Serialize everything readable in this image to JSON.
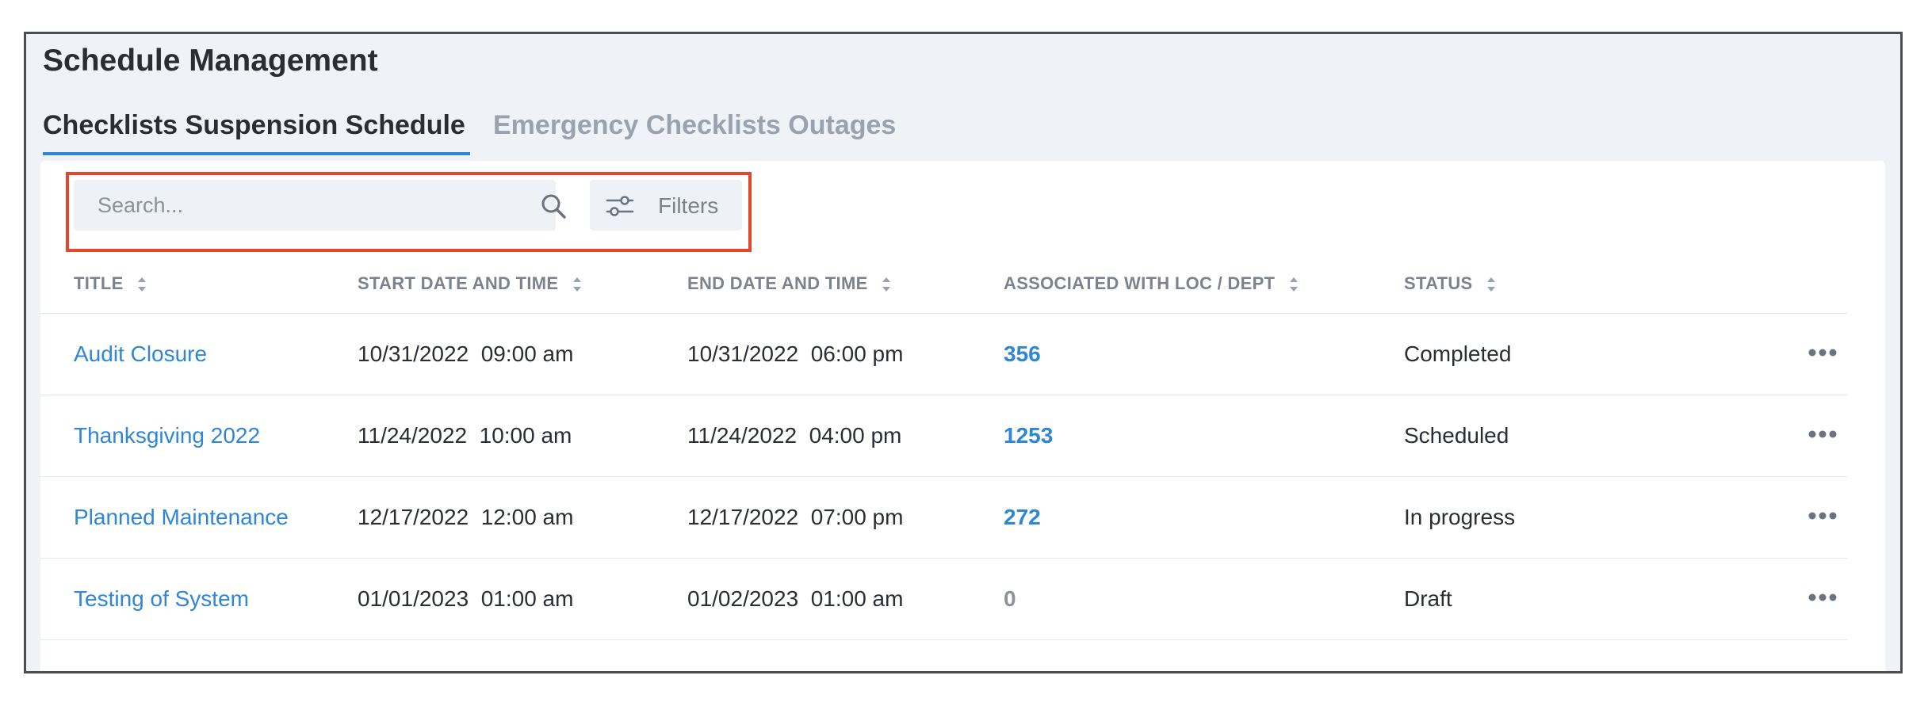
{
  "page": {
    "title": "Schedule Management"
  },
  "tabs": [
    {
      "label": "Checklists Suspension Schedule",
      "active": true
    },
    {
      "label": "Emergency Checklists Outages",
      "active": false
    }
  ],
  "toolbar": {
    "search_placeholder": "Search...",
    "search_value": "",
    "search_icon": "search-icon",
    "filters_label": "Filters",
    "filters_icon": "sliders-icon"
  },
  "table": {
    "columns": [
      "TITLE",
      "START DATE AND TIME",
      "END DATE AND TIME",
      "ASSOCIATED WITH LOC / DEPT",
      "STATUS"
    ],
    "rows": [
      {
        "title": "Audit Closure",
        "start": "10/31/2022  09:00 am",
        "end": "10/31/2022  06:00 pm",
        "associated": "356",
        "status": "Completed"
      },
      {
        "title": "Thanksgiving 2022",
        "start": "11/24/2022  10:00 am",
        "end": "11/24/2022  04:00 pm",
        "associated": "1253",
        "status": "Scheduled"
      },
      {
        "title": "Planned Maintenance",
        "start": "12/17/2022  12:00 am",
        "end": "12/17/2022  07:00 pm",
        "associated": "272",
        "status": "In progress"
      },
      {
        "title": "Testing of System",
        "start": "01/01/2023  01:00 am",
        "end": "01/02/2023  01:00 am",
        "associated": "0",
        "status": "Draft"
      }
    ],
    "row_action_icon": "more-horizontal-icon"
  },
  "colors": {
    "accent": "#2f86d6",
    "highlight": "#e2462c",
    "background": "#eff2f6",
    "text": "#2a2e34",
    "muted": "#9aa2ae"
  }
}
